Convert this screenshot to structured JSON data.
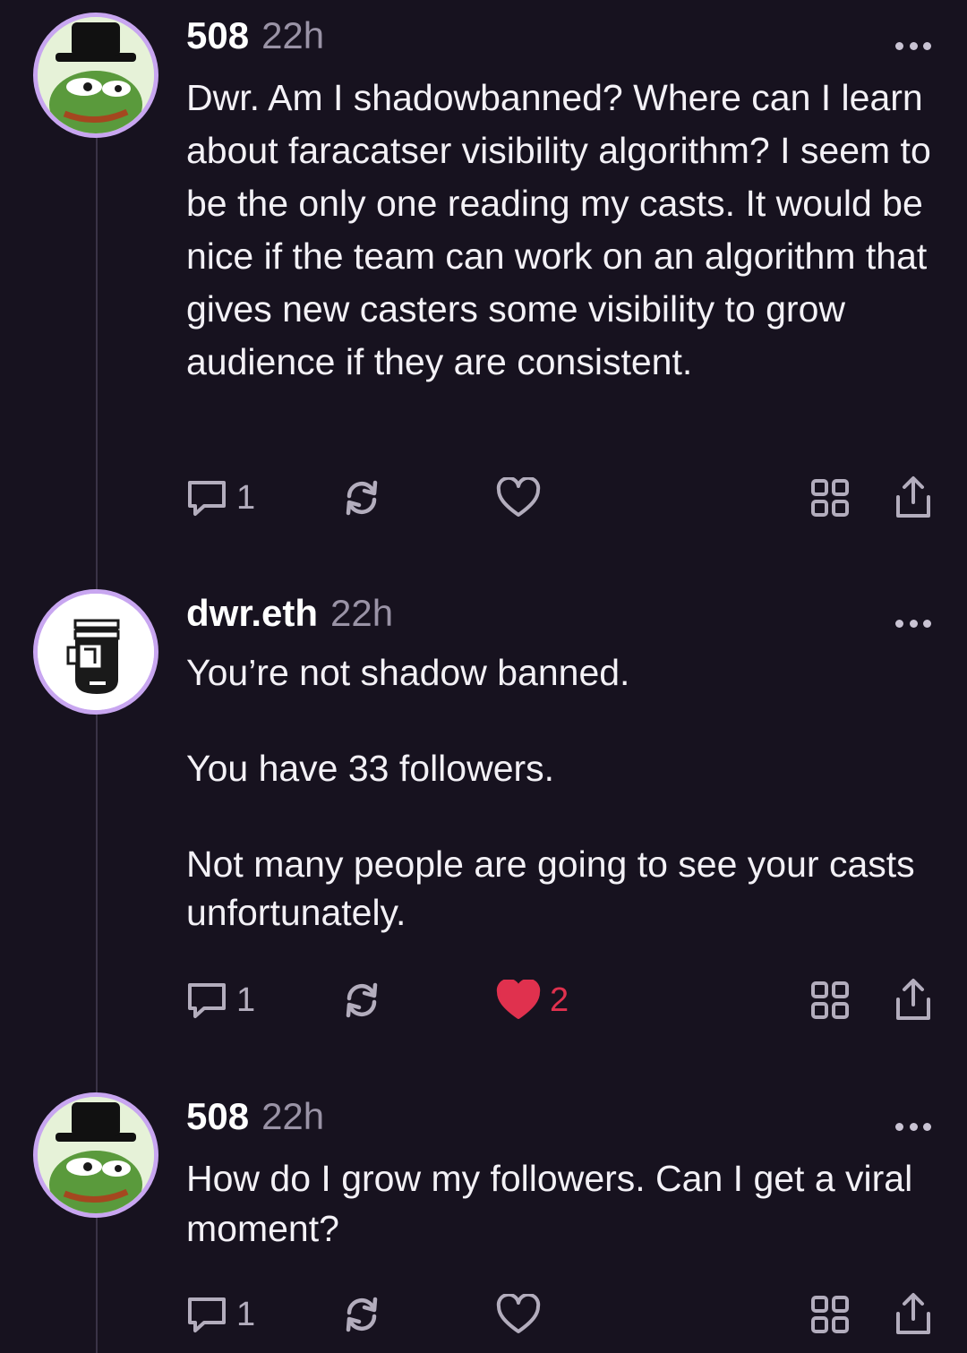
{
  "casts": [
    {
      "author": "508",
      "time": "22h",
      "avatar": "pepe-avatar",
      "text": "Dwr. Am I shadowbanned? Where can I learn about faracatser visibility algorithm? I seem to be the only one reading my casts. It would be nice if the team can work on an algorithm that gives new casters some visibility to grow audience if they are consistent.",
      "replies": "1",
      "likes": "",
      "liked": false
    },
    {
      "author": "dwr.eth",
      "time": "22h",
      "avatar": "dwr-avatar",
      "text": "You’re not shadow banned.\n\nYou have 33 followers.\n\nNot many people are going to see your casts unfortunately.",
      "replies": "1",
      "likes": "2",
      "liked": true
    },
    {
      "author": "508",
      "time": "22h",
      "avatar": "pepe-avatar",
      "text": "How do I grow my followers. Can I get a viral moment?",
      "replies": "1",
      "likes": "",
      "liked": false
    }
  ],
  "colors": {
    "background": "#17121f",
    "like_active": "#e0314e",
    "avatar_ring": "#c8a6f0"
  },
  "icons": [
    "comment-icon",
    "recast-icon",
    "heart-icon",
    "grid-icon",
    "share-icon",
    "more-icon"
  ]
}
